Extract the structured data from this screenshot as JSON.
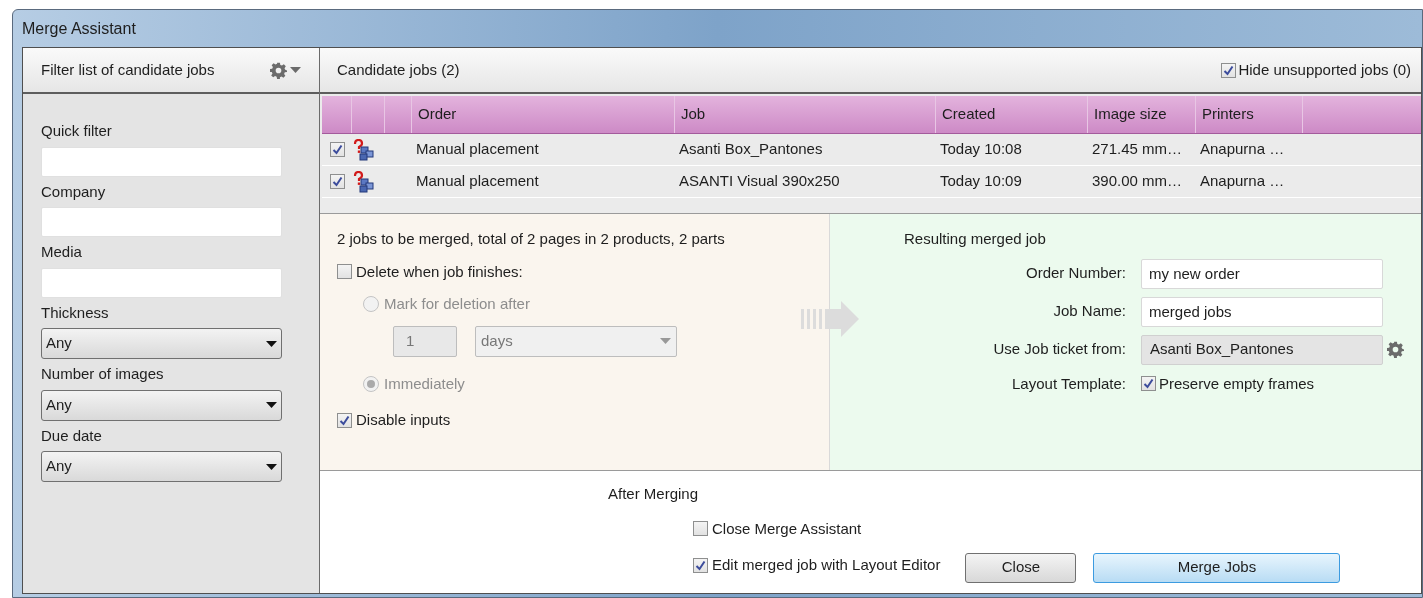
{
  "window": {
    "title": "Merge Assistant"
  },
  "filter_panel": {
    "title": "Filter list of candidate jobs",
    "fields": [
      {
        "kind": "text",
        "label": "Quick filter"
      },
      {
        "kind": "text",
        "label": "Company"
      },
      {
        "kind": "text",
        "label": "Media"
      },
      {
        "kind": "select",
        "label": "Thickness",
        "value": "Any"
      },
      {
        "kind": "select",
        "label": "Number of images",
        "value": "Any"
      },
      {
        "kind": "select",
        "label": "Due date",
        "value": "Any"
      }
    ]
  },
  "candidates": {
    "title": "Candidate jobs (2)",
    "hide_unsupported": {
      "label": "Hide unsupported jobs (0)",
      "checked": true
    },
    "table": {
      "columns": [
        "Order",
        "Job",
        "Created",
        "Image size",
        "Printers"
      ],
      "rows": [
        {
          "checked": true,
          "cells": [
            "Manual placement",
            "Asanti Box_Pantones",
            "Today 10:08",
            "271.45 mm…",
            "Anapurna …"
          ]
        },
        {
          "checked": true,
          "cells": [
            "Manual placement",
            "ASANTI Visual 390x250",
            "Today 10:09",
            "390.00 mm…",
            "Anapurna …"
          ]
        }
      ]
    }
  },
  "summary": {
    "text": "2 jobs to be merged, total of 2 pages in 2 products, 2 parts",
    "delete_when_finishes": {
      "label": "Delete when job finishes:",
      "checked": false
    },
    "deletion_options": [
      {
        "label": "Mark for deletion after",
        "selected": false,
        "disabled": true
      },
      {
        "label": "Immediately",
        "selected": true,
        "disabled": true
      }
    ],
    "after_count": "1",
    "after_unit": "days",
    "disable_inputs": {
      "label": "Disable inputs",
      "checked": true
    }
  },
  "result": {
    "title": "Resulting merged job",
    "fields": [
      {
        "kind": "input",
        "label": "Order Number:",
        "value": "my new order"
      },
      {
        "kind": "input",
        "label": "Job Name:",
        "value": "merged jobs"
      },
      {
        "kind": "readonly",
        "label": "Use Job ticket from:",
        "value": "Asanti Box_Pantones"
      },
      {
        "kind": "checkbox",
        "label": "Layout Template:",
        "value": "Preserve empty frames",
        "checked": true
      }
    ]
  },
  "after_merging": {
    "title": "After Merging",
    "options": [
      {
        "label": "Close Merge Assistant",
        "checked": false
      },
      {
        "label": "Edit merged job with Layout Editor",
        "checked": true
      }
    ]
  },
  "buttons": [
    {
      "label": "Close",
      "default": false
    },
    {
      "label": "Merge Jobs",
      "default": true
    }
  ]
}
